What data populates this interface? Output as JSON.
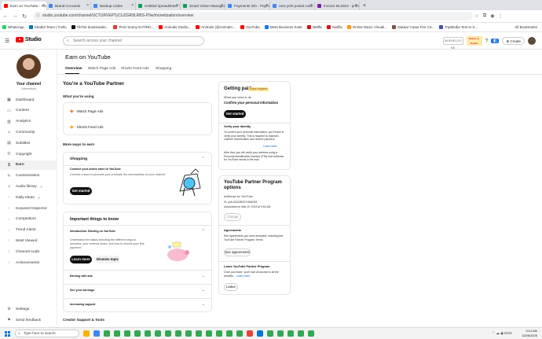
{
  "browser": {
    "tabs": [
      {
        "label": "Earn on YouTube - YouTube S",
        "color": "#ff0000",
        "active": true
      },
      {
        "label": "Brand Accounts",
        "color": "#4285f4",
        "active": false
      },
      {
        "label": "Backup codes",
        "color": "#4285f4",
        "active": false
      },
      {
        "label": "Untitled spreadsheet - G",
        "color": "#0f9d58",
        "active": false
      },
      {
        "label": "Smart Vision Management",
        "color": "#0f9d58",
        "active": false
      },
      {
        "label": "Payments info - Payment",
        "color": "#4285f4",
        "active": false
      },
      {
        "label": "new york postal code - G",
        "color": "#4285f4",
        "active": false
      },
      {
        "label": "Invoice BL2023 - prime dkt",
        "color": "#7b1fa2",
        "active": false
      }
    ],
    "new_tab": "+",
    "url": "studio.youtube.com/channel/UCTURVEPTyCUZGR9LRBS-P9w/monetization/overview",
    "bookmarks": [
      {
        "label": "WhatsApp",
        "color": "#25d366"
      },
      {
        "label": "Shahid Team | Trello",
        "color": "#0079bf"
      },
      {
        "label": "TikTok downloader...",
        "color": "#111111"
      },
      {
        "label": "PHU Sunny EATING...",
        "color": "#e53935"
      },
      {
        "label": "Animals Studio...",
        "color": "#ff0000"
      },
      {
        "label": "Animals (@AnimalA...",
        "color": "#ff0000"
      },
      {
        "label": "YouTube",
        "color": "#ff0000"
      },
      {
        "label": "Meta Business Suite",
        "color": "#1877f2"
      },
      {
        "label": "Netflix",
        "color": "#e50914"
      },
      {
        "label": "Netflix",
        "color": "#e50914"
      },
      {
        "label": "Online Music Visuali...",
        "color": "#ff9800"
      },
      {
        "label": "Sakaar Casar Fire Ca...",
        "color": "#795548"
      },
      {
        "label": "TopMedia Text to S...",
        "color": "#3f51b5"
      }
    ],
    "all_bookmarks": "All Bookmarks"
  },
  "header": {
    "brand": "Studio",
    "search_placeholder": "Search across your channel",
    "mini_widget": "00:00:00 | 0.0 KB",
    "promo_text": "Beasts by Studios",
    "create_label": "Create"
  },
  "sidebar": {
    "channel_label": "Your channel",
    "channel_name": "Otherwised",
    "items": [
      {
        "label": "Dashboard",
        "icon": "dashboard-icon",
        "glyph": "▦"
      },
      {
        "label": "Content",
        "icon": "content-icon",
        "glyph": "▭"
      },
      {
        "label": "Analytics",
        "icon": "analytics-icon",
        "glyph": "▥"
      },
      {
        "label": "Community",
        "icon": "community-icon",
        "glyph": "☺"
      },
      {
        "label": "Subtitles",
        "icon": "subtitles-icon",
        "glyph": "▤"
      },
      {
        "label": "Copyright",
        "icon": "copyright-icon",
        "glyph": "©"
      },
      {
        "label": "Earn",
        "icon": "earn-icon",
        "glyph": "$"
      },
      {
        "label": "Customization",
        "icon": "customization-icon",
        "glyph": "✎"
      },
      {
        "label": "Audio library",
        "icon": "audio-library-icon",
        "glyph": "♫"
      },
      {
        "label": "Daily Ideas",
        "icon": "daily-ideas-icon",
        "glyph": "◌"
      },
      {
        "label": "Keyword Inspector",
        "icon": "keyword-inspector-icon",
        "glyph": "◌"
      },
      {
        "label": "Competitors",
        "icon": "competitors-icon",
        "glyph": "◌"
      },
      {
        "label": "Trend Alerts",
        "icon": "trend-alerts-icon",
        "glyph": "◌"
      },
      {
        "label": "Most Viewed",
        "icon": "most-viewed-icon",
        "glyph": "◌"
      },
      {
        "label": "Channel Audit",
        "icon": "channel-audit-icon",
        "glyph": "◌"
      },
      {
        "label": "Achievements",
        "icon": "achievements-icon",
        "glyph": "◌"
      }
    ],
    "settings_label": "Settings",
    "feedback_label": "Send feedback"
  },
  "main": {
    "title": "Earn on YouTube",
    "tabs": [
      "Overview",
      "Watch Page Ads",
      "Shorts Feed Ads",
      "Shopping"
    ],
    "partner_heading": "You're a YouTube Partner",
    "using_heading": "What you're using",
    "using_items": [
      "Watch Page Ads",
      "Shorts Feed Ads"
    ],
    "more_ways_heading": "More ways to earn",
    "shopping": {
      "title": "Shopping",
      "subtitle": "Connect your online store to YouTube",
      "desc": "Connect a store to promote your products: the merchandise on your channel",
      "button": "Get started"
    },
    "important": {
      "title": "Important things to know",
      "intro_title": "Introduction: Earning on YouTube",
      "intro_desc": "Understand the basics including the different ways to monetize, your revenue share, and how to receive your first payment",
      "learn_more": "Learn more",
      "dismiss": "Dismiss topic",
      "items": [
        "Earning with ads",
        "See your earnings",
        "Increasing support"
      ]
    },
    "creator_support": "Creator Support & Tools"
  },
  "right": {
    "getting_paid": {
      "title": "Getting paid",
      "badge": "Action required",
      "need_label": "What you need to do",
      "need_action": "Confirm your personal information",
      "button": "Get started",
      "verify_title": "Verify your identity",
      "verify_text": "To confirm your personal information, you'll have to verify your identity. This is required to maintain channel monetization and receive payment.",
      "verify_link": "Learn more",
      "after_text": "After that, you will verify your address using a Personal Identification Number (PIN) that AdSense for YouTube sends in the mail."
    },
    "program": {
      "title": "YouTube Partner Program options",
      "adsense_label": "AdSense for YouTube",
      "adsense_id": "ID: pub-0021892371566783",
      "associated": "Associated on Mar 19, 2023 at 9:51 AM",
      "change_btn": "Change",
      "agreements_title": "Agreements",
      "agreements_text": "See agreements you have accepted, including the YouTube Partner Program Terms.",
      "agreements_btn": "See agreements",
      "leave_title": "Leave YouTube Partner Program",
      "leave_text": "Once you leave, you'll lose all access to all the benefits.",
      "leave_link": "Learn more",
      "leave_btn": "Leave"
    }
  },
  "taskbar": {
    "search": "Type here to search",
    "time": "9:14 AM",
    "date": "11/06/2025",
    "tray": "⌃ ☁ ◉ ENG"
  }
}
